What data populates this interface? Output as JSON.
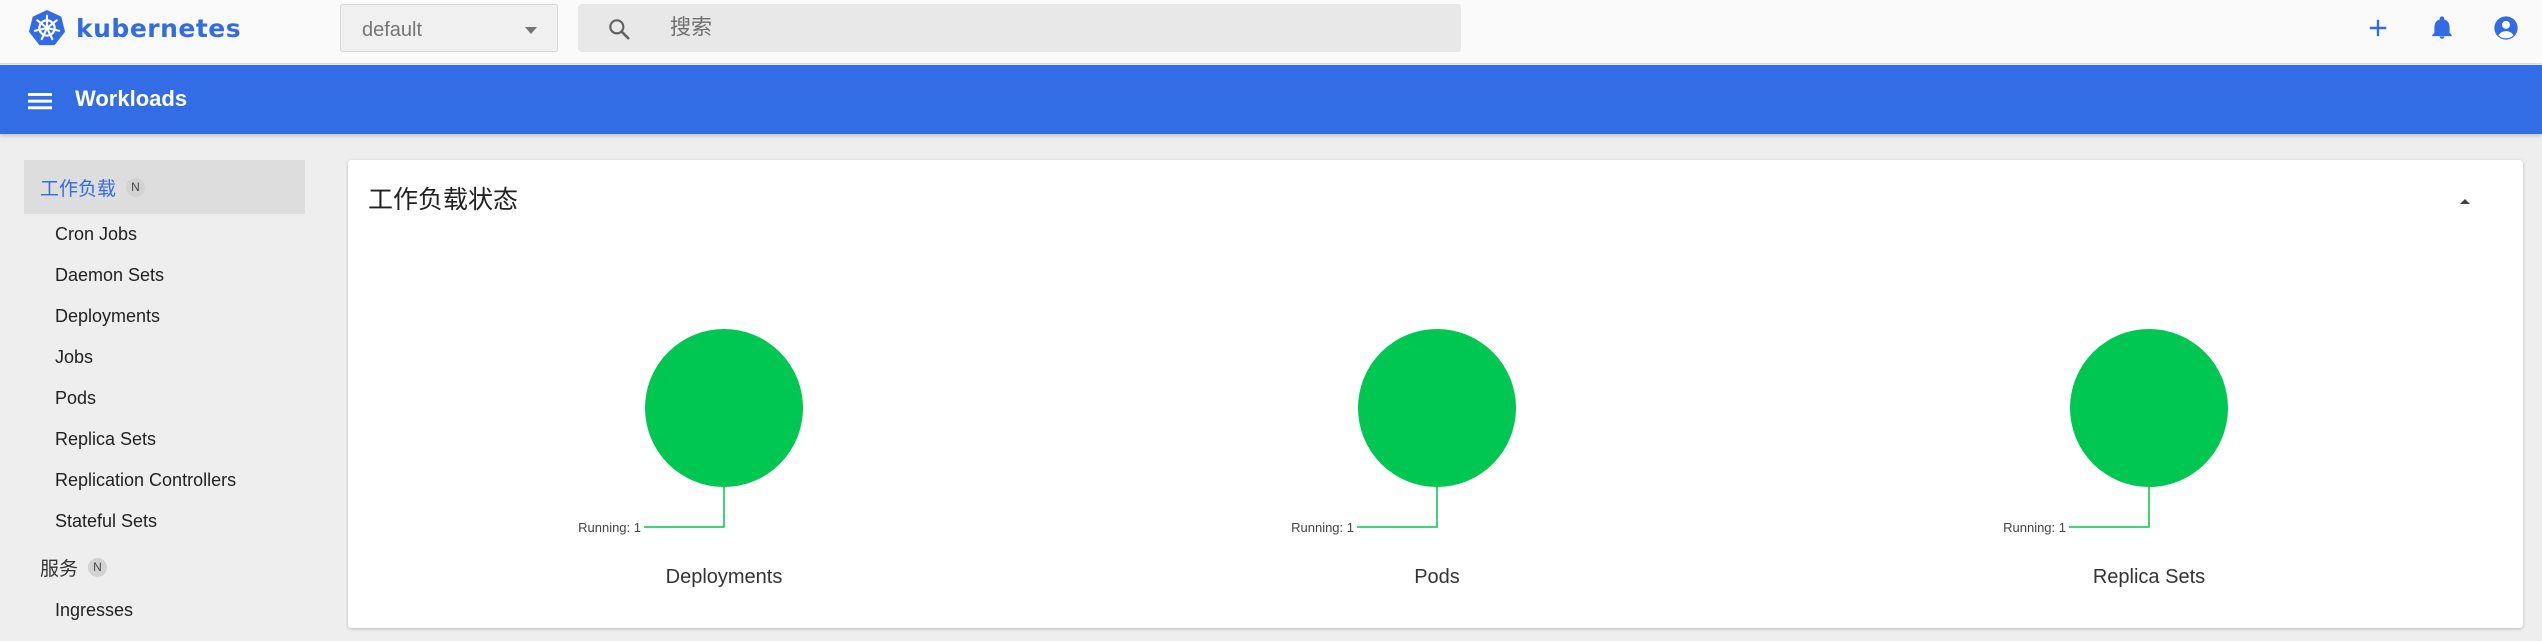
{
  "app": {
    "brand": "kubernetes"
  },
  "namespace": {
    "selected": "default"
  },
  "search": {
    "placeholder": "搜索"
  },
  "toolbar": {
    "title": "Workloads"
  },
  "sidebar": {
    "categories": [
      {
        "label": "工作负载",
        "badge": "N",
        "items": [
          "Cron Jobs",
          "Daemon Sets",
          "Deployments",
          "Jobs",
          "Pods",
          "Replica Sets",
          "Replication Controllers",
          "Stateful Sets"
        ]
      },
      {
        "label": "服务",
        "badge": "N",
        "items": [
          "Ingresses"
        ]
      }
    ]
  },
  "card": {
    "title": "工作负载状态",
    "charts": [
      {
        "label": "Deployments",
        "running_label": "Running: 1",
        "running": 1
      },
      {
        "label": "Pods",
        "running_label": "Running: 1",
        "running": 1
      },
      {
        "label": "Replica Sets",
        "running_label": "Running: 1",
        "running": 1
      }
    ]
  },
  "colors": {
    "accent": "#326ce5",
    "toolbar": "#326de6",
    "running": "#00c752"
  },
  "icons": {
    "brand": "kubernetes-logo-icon",
    "search": "search-icon",
    "ns_dropdown": "chevron-down-icon",
    "create": "plus-icon",
    "notifications": "bell-icon",
    "account": "account-circle-icon",
    "menu": "menu-icon",
    "collapse": "chevron-up-icon"
  }
}
